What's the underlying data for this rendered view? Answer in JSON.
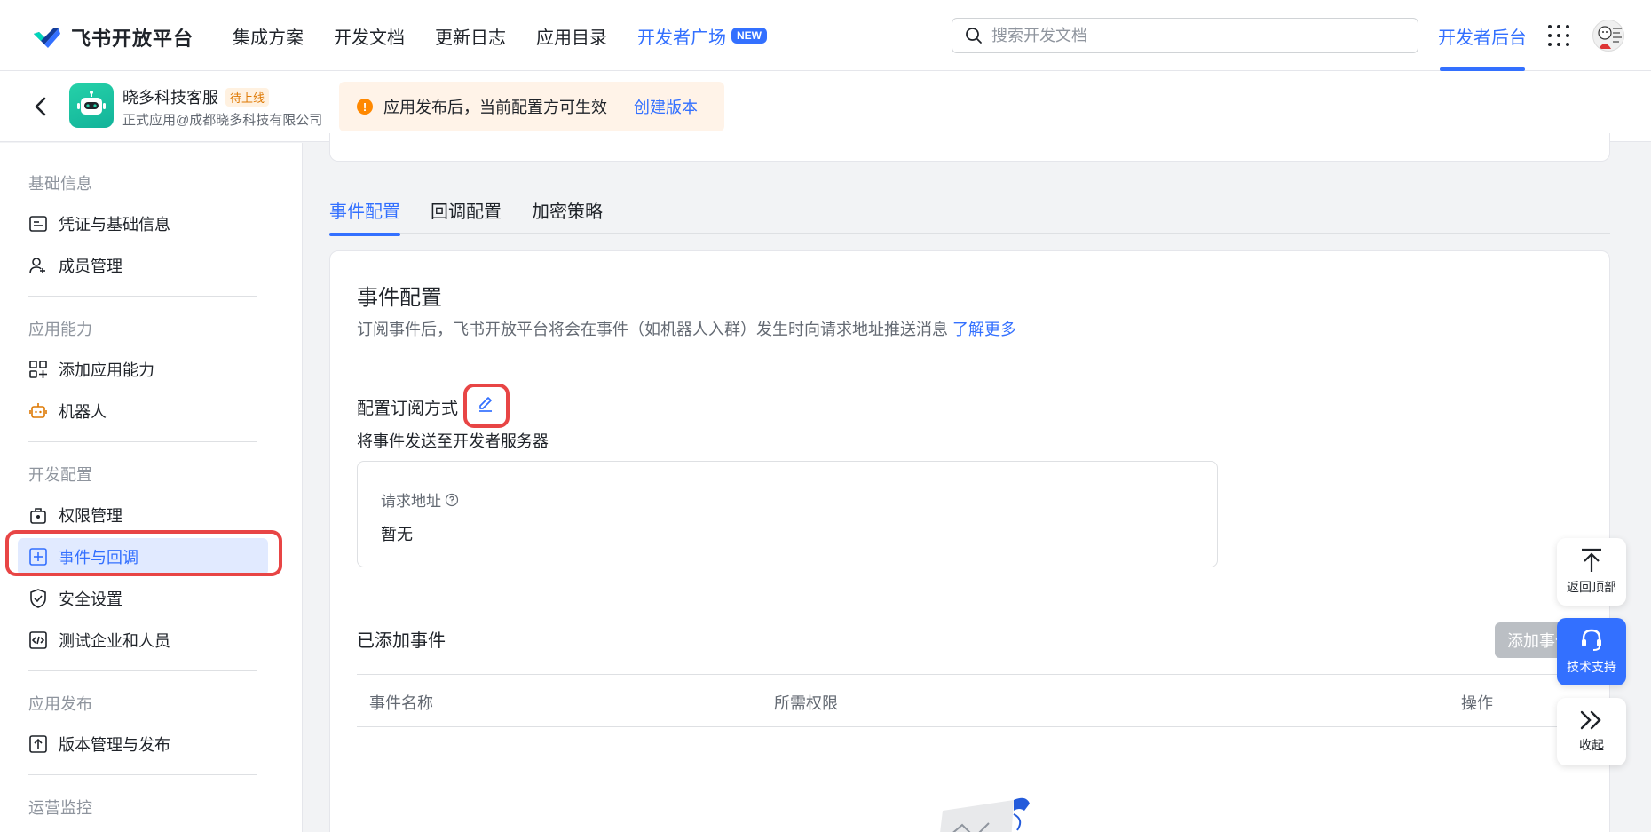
{
  "topnav": {
    "logo_text": "飞书开放平台",
    "links": [
      "集成方案",
      "开发文档",
      "更新日志",
      "应用目录"
    ],
    "dev_square": "开发者广场",
    "new_badge": "NEW",
    "search_placeholder": "搜索开发文档",
    "console": "开发者后台"
  },
  "app": {
    "name": "晓多科技客服",
    "status": "待上线",
    "org": "正式应用@成都晓多科技有限公司"
  },
  "notice": {
    "text": "应用发布后，当前配置方可生效",
    "link": "创建版本"
  },
  "sidebar": {
    "groups": [
      "基础信息",
      "应用能力",
      "开发配置",
      "应用发布",
      "运营监控"
    ],
    "items": {
      "credentials": "凭证与基础信息",
      "members": "成员管理",
      "add_capability": "添加应用能力",
      "robot": "机器人",
      "permissions": "权限管理",
      "events": "事件与回调",
      "security": "安全设置",
      "test_org": "测试企业和人员",
      "versions": "版本管理与发布"
    }
  },
  "tabs": [
    "事件配置",
    "回调配置",
    "加密策略"
  ],
  "main": {
    "title": "事件配置",
    "desc": "订阅事件后，飞书开放平台将会在事件（如机器人入群）发生时向请求地址推送消息",
    "learn_more": "了解更多",
    "subscribe_label": "配置订阅方式",
    "subscribe_desc": "将事件发送至开发者服务器",
    "url_label": "请求地址",
    "url_value": "暂无",
    "added_title": "已添加事件",
    "add_button": "添加事件",
    "columns": [
      "事件名称",
      "所需权限",
      "操作"
    ]
  },
  "float_panel": {
    "back_top": "返回顶部",
    "support": "技术支持",
    "collapse": "收起"
  },
  "colors": {
    "accent": "#3370ff",
    "highlight": "#e84545",
    "warning": "#ff8800"
  }
}
